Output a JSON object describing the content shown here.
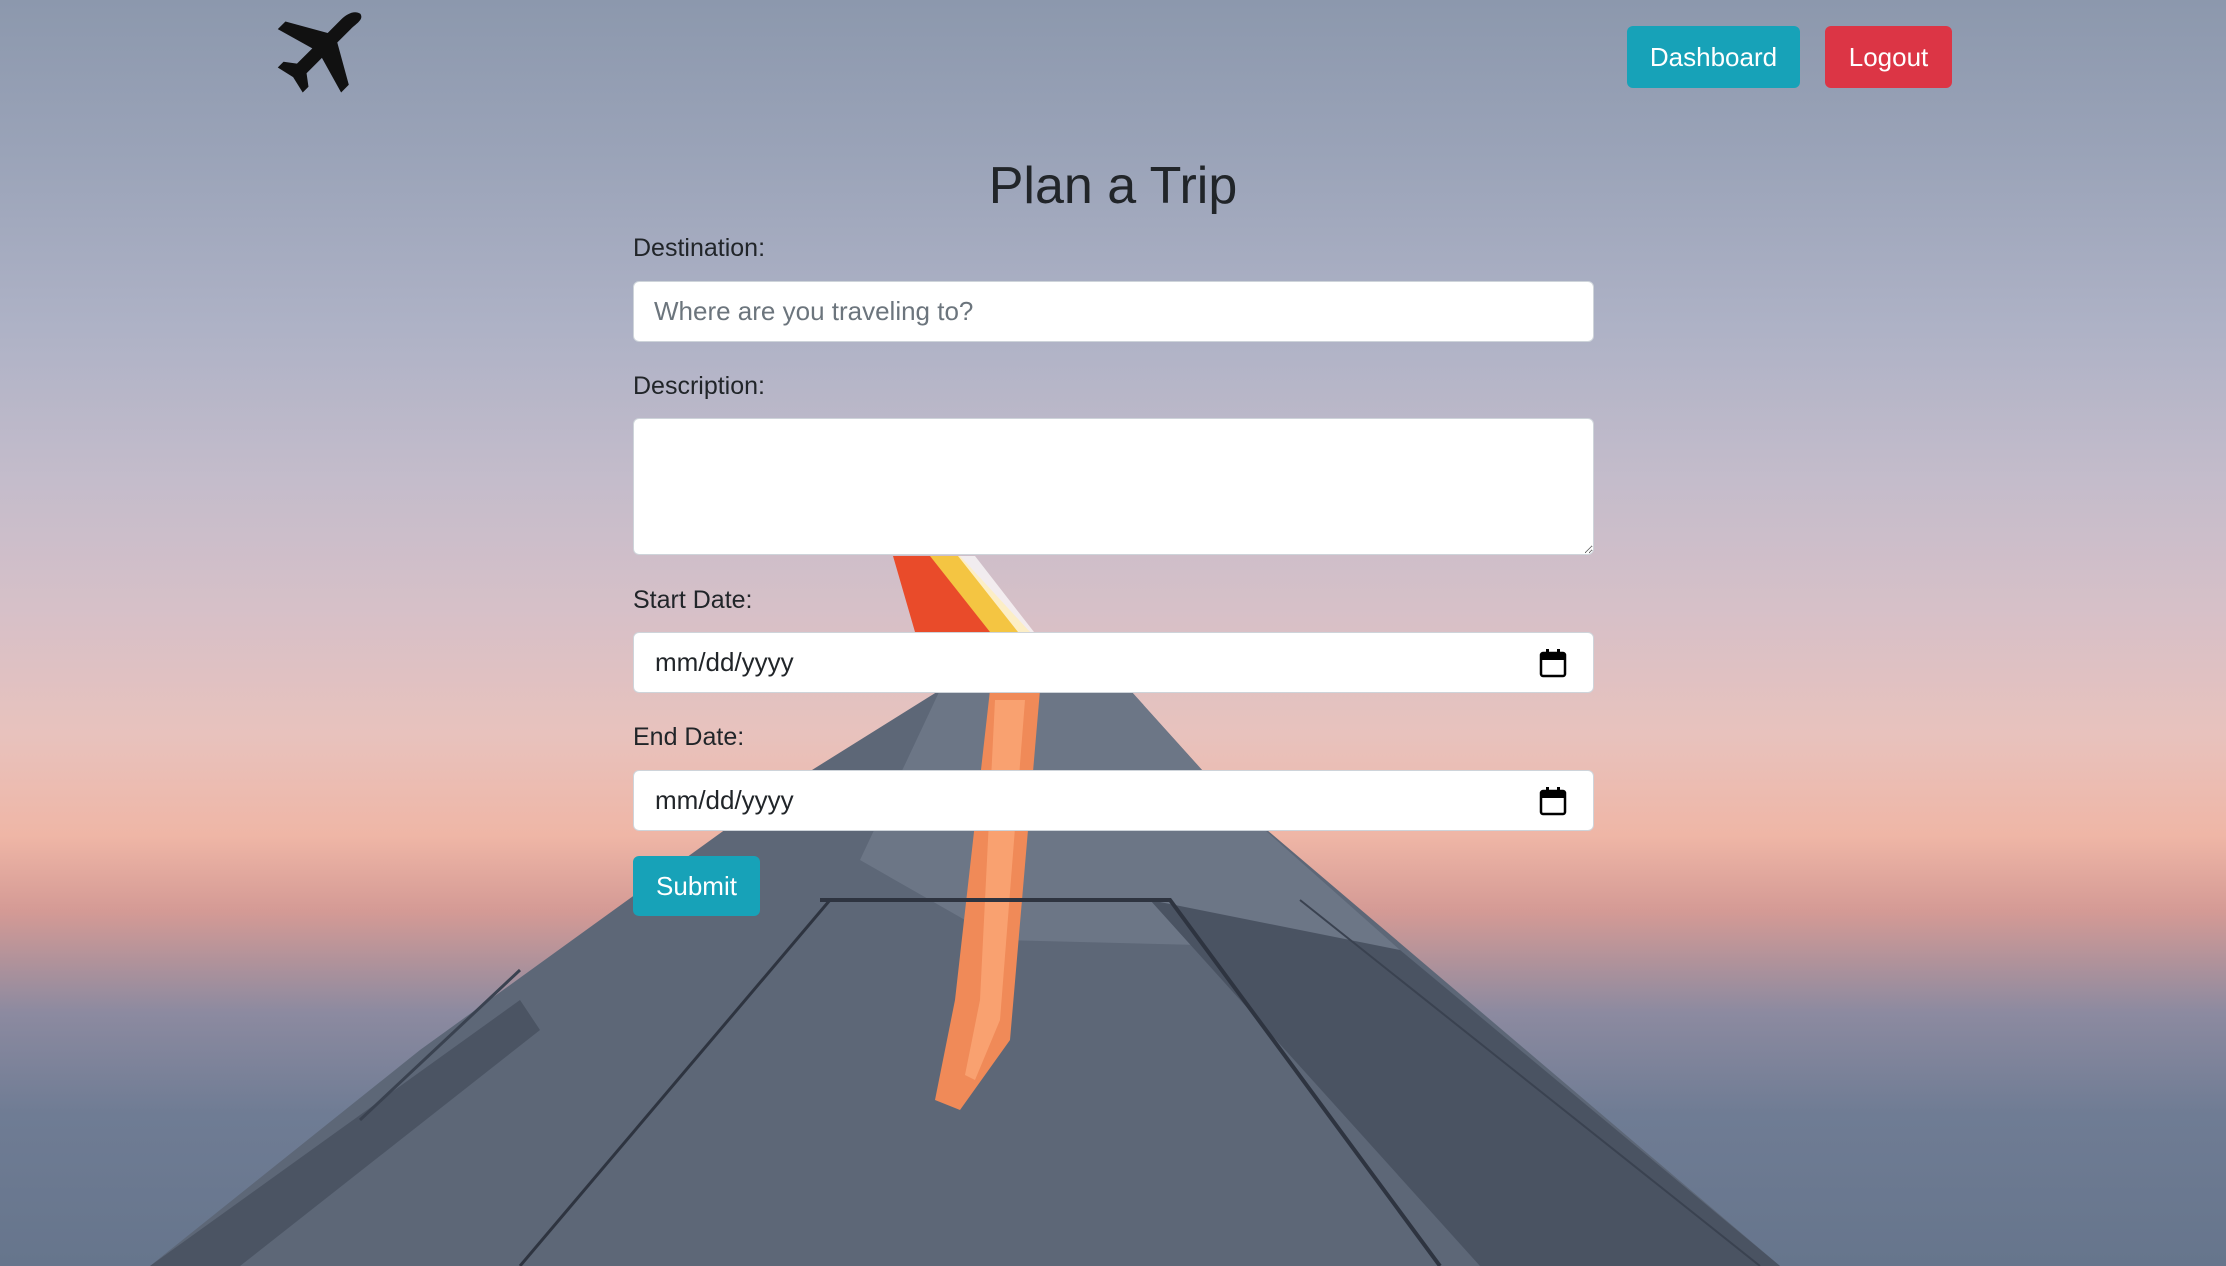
{
  "header": {
    "logo_icon": "airplane-icon",
    "dashboard_label": "Dashboard",
    "logout_label": "Logout"
  },
  "form": {
    "title": "Plan a Trip",
    "destination_label": "Destination:",
    "destination_placeholder": "Where are you traveling to?",
    "description_label": "Description:",
    "description_value": "",
    "start_date_label": "Start Date:",
    "start_date_value": "mm/dd/yyyy",
    "end_date_label": "End Date:",
    "end_date_value": "mm/dd/yyyy",
    "submit_label": "Submit"
  },
  "colors": {
    "info": "#17a2b8",
    "danger": "#dc3545"
  }
}
